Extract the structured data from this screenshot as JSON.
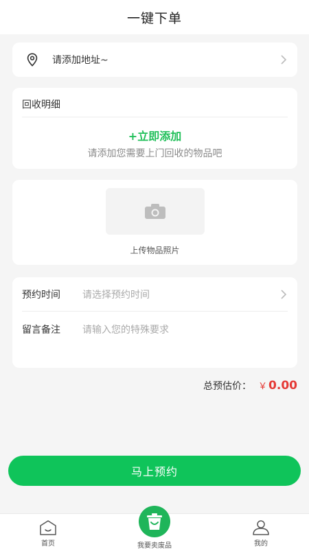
{
  "header": {
    "title": "一键下单"
  },
  "address": {
    "text": "请添加地址~"
  },
  "detail": {
    "heading": "回收明细",
    "add_label": "+立即添加",
    "hint": "请添加您需要上门回收的物品吧"
  },
  "photo": {
    "caption": "上传物品照片"
  },
  "form": {
    "time_label": "预约时间",
    "time_placeholder": "请选择预约时间",
    "note_label": "留言备注",
    "note_placeholder": "请输入您的特殊要求"
  },
  "total": {
    "label": "总预估价：",
    "currency": "￥",
    "amount": "0.00"
  },
  "submit": {
    "label": "马上预约"
  },
  "tabs": [
    {
      "label": "首页",
      "icon": "home-icon"
    },
    {
      "label": "我要卖废品",
      "icon": "recycle-bin-icon"
    },
    {
      "label": "我的",
      "icon": "user-icon"
    }
  ],
  "colors": {
    "accent": "#0fc45a",
    "price": "#e53935"
  }
}
